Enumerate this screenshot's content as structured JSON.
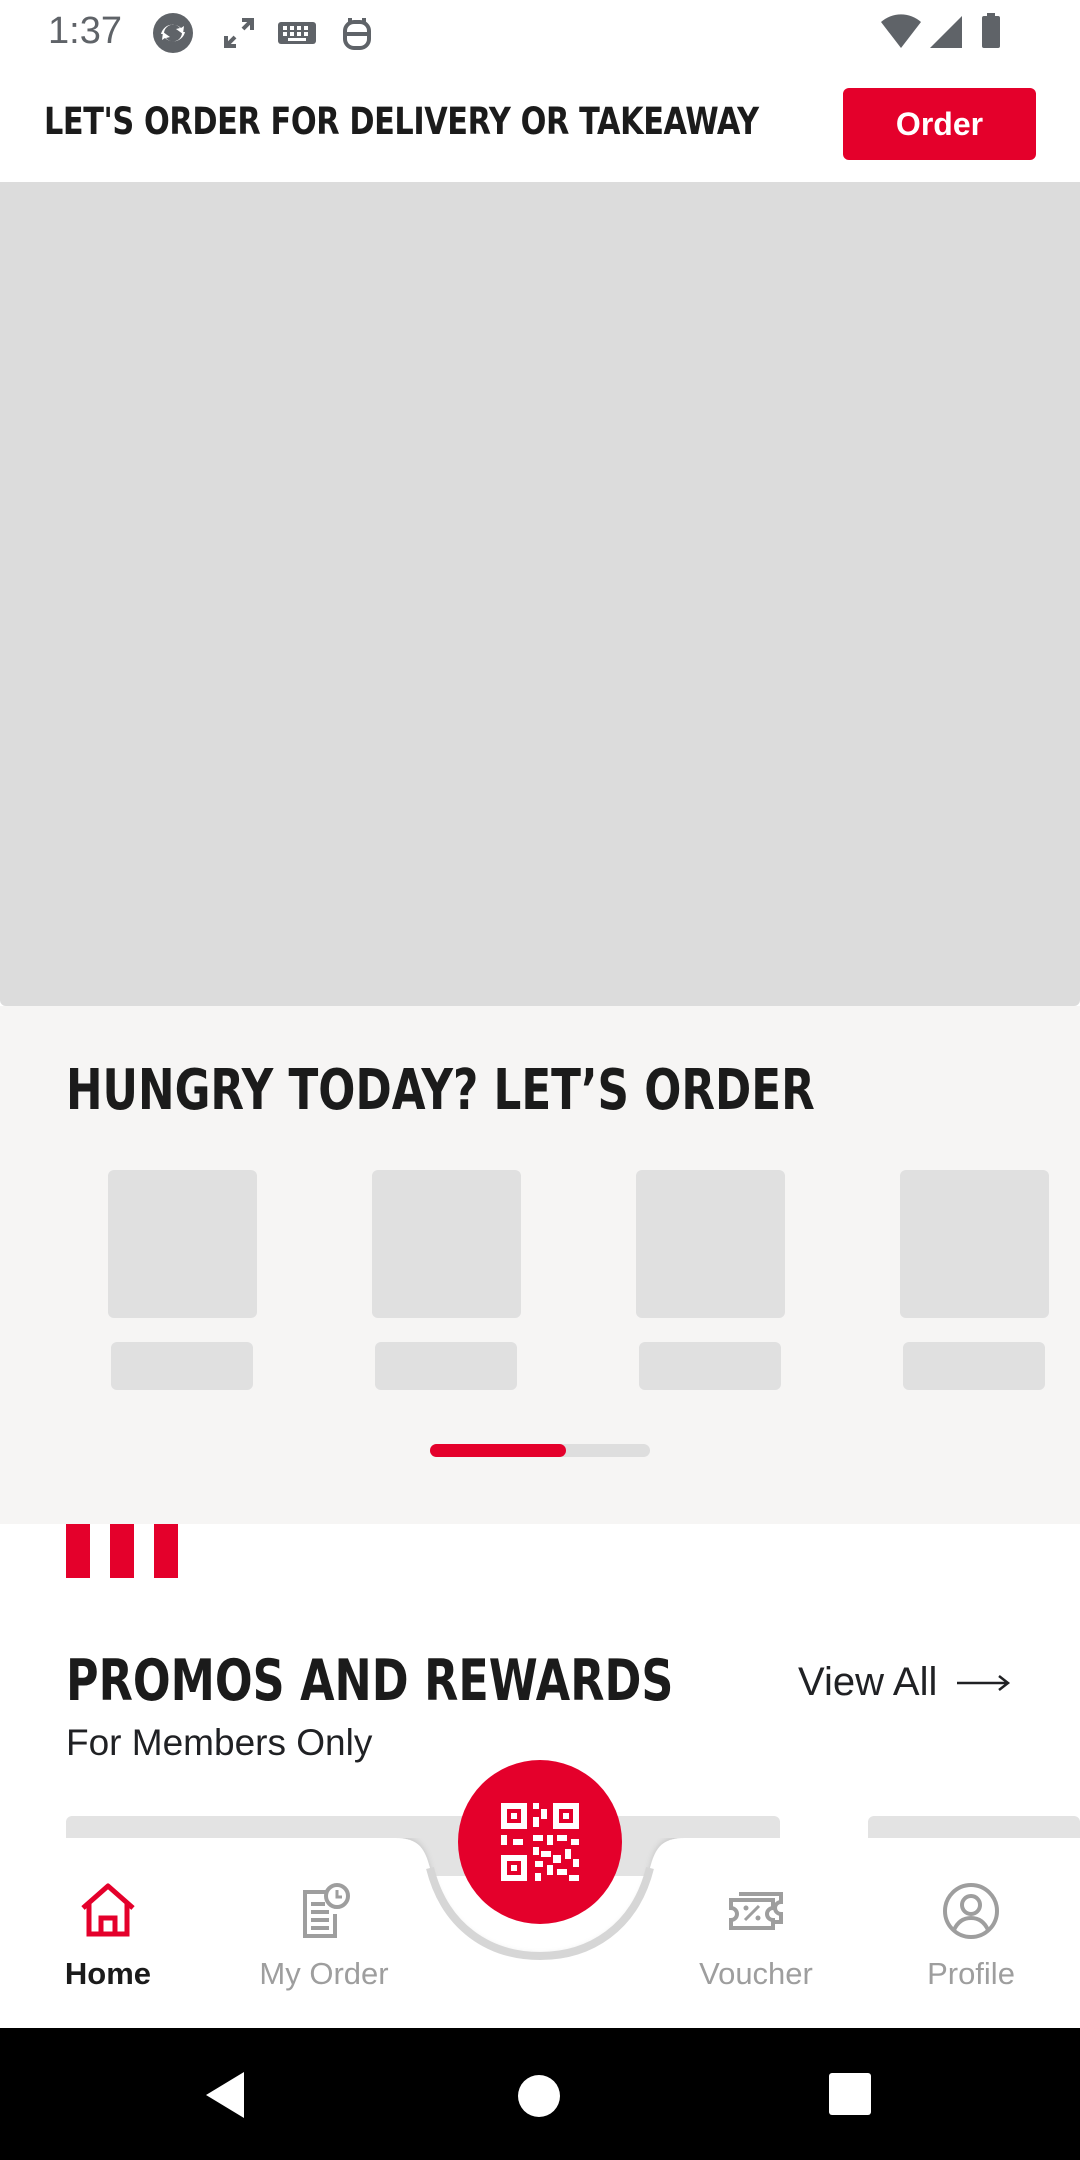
{
  "status_bar": {
    "time": "1:37",
    "left_icons": [
      "sync-icon",
      "expand-icon",
      "keyboard-icon",
      "accessibility-icon"
    ],
    "right_icons": [
      "wifi-icon",
      "signal-icon",
      "battery-icon"
    ]
  },
  "header": {
    "title": "LET'S ORDER FOR DELIVERY OR TAKEAWAY",
    "order_button": "Order"
  },
  "hungry": {
    "title": "HUNGRY TODAY? LET’S ORDER",
    "carousel_progress": 0.62
  },
  "promos": {
    "title": "PROMOS AND REWARDS",
    "subtitle": "For Members Only",
    "view_all": "View All"
  },
  "bottom_nav": {
    "items": [
      {
        "label": "Home",
        "icon": "home-icon",
        "active": true
      },
      {
        "label": "My Order",
        "icon": "order-history-icon",
        "active": false
      },
      {
        "label": "Voucher",
        "icon": "voucher-icon",
        "active": false
      },
      {
        "label": "Profile",
        "icon": "profile-icon",
        "active": false
      }
    ],
    "center_button_icon": "qr-code-icon"
  },
  "colors": {
    "brand_red": "#e4002b",
    "placeholder_gray": "#dcdcdc",
    "section_bg": "#f6f5f4"
  }
}
